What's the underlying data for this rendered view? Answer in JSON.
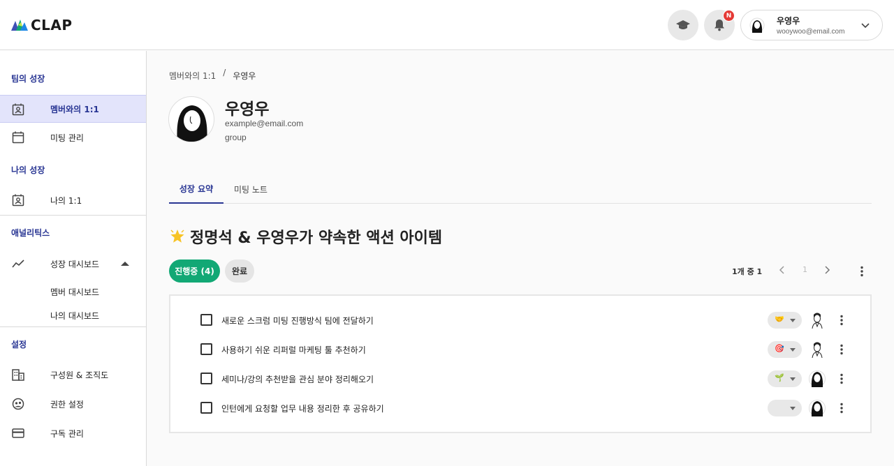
{
  "app": {
    "logo_text": "CLAP"
  },
  "header": {
    "notification_badge": "N",
    "user": {
      "name": "우영우",
      "email": "wooywoo@email.com"
    }
  },
  "sidebar": {
    "sections": [
      {
        "title": "팀의 성장",
        "items": [
          {
            "label": "멤버와의 1:1",
            "icon": "person-card-icon",
            "active": true
          },
          {
            "label": "미팅 관리",
            "icon": "calendar-icon"
          }
        ]
      },
      {
        "title": "나의 성장",
        "items": [
          {
            "label": "나의 1:1",
            "icon": "calendar-person-icon"
          }
        ]
      },
      {
        "title": "애널리틱스",
        "items": [
          {
            "label": "성장 대시보드",
            "icon": "trend-line-icon",
            "sub": [
              "멤버 대시보드",
              "나의 대시보드"
            ]
          }
        ]
      },
      {
        "title": "설정",
        "items": [
          {
            "label": "구성원 & 조직도",
            "icon": "building-icon"
          },
          {
            "label": "권한 설정",
            "icon": "user-shield-icon"
          },
          {
            "label": "구독 관리",
            "icon": "credit-card-icon"
          }
        ]
      }
    ]
  },
  "main": {
    "breadcrumb": {
      "parent": "멤버와의 1:1",
      "separator": "/",
      "current": "우영우"
    },
    "profile": {
      "name": "우영우",
      "email": "example@email.com",
      "group": "group"
    },
    "tabs": [
      "성장 요약",
      "미팅 노트"
    ],
    "section_title": "정명석 & 우영우가 약속한 액션 아이템",
    "filters": {
      "in_progress": "진행중 (4)",
      "done": "완료"
    },
    "pagination": {
      "count_label": "1개 중 1",
      "page": "1"
    },
    "action_items": [
      {
        "text": "새로운 스크럼 미팅 진행방식 팀에 전달하기",
        "emoji": "🤝",
        "assignee": "man-avatar-icon"
      },
      {
        "text": "사용하기 쉬운 리퍼럴 마케팅 툴 추천하기",
        "emoji": "🎯",
        "assignee": "man-avatar-icon"
      },
      {
        "text": "세미나/강의 추천받을 관심 분야 정리해오기",
        "emoji": "🌱",
        "assignee": "woman-avatar-icon"
      },
      {
        "text": "인턴에게 요청할 업무 내용 정리한 후 공유하기",
        "emoji": "",
        "assignee": "woman-avatar-icon"
      }
    ]
  },
  "colors": {
    "primary": "#283593",
    "accent_green": "#12a875",
    "badge_red": "#e53935",
    "active_nav_bg": "#e3e4fb"
  }
}
